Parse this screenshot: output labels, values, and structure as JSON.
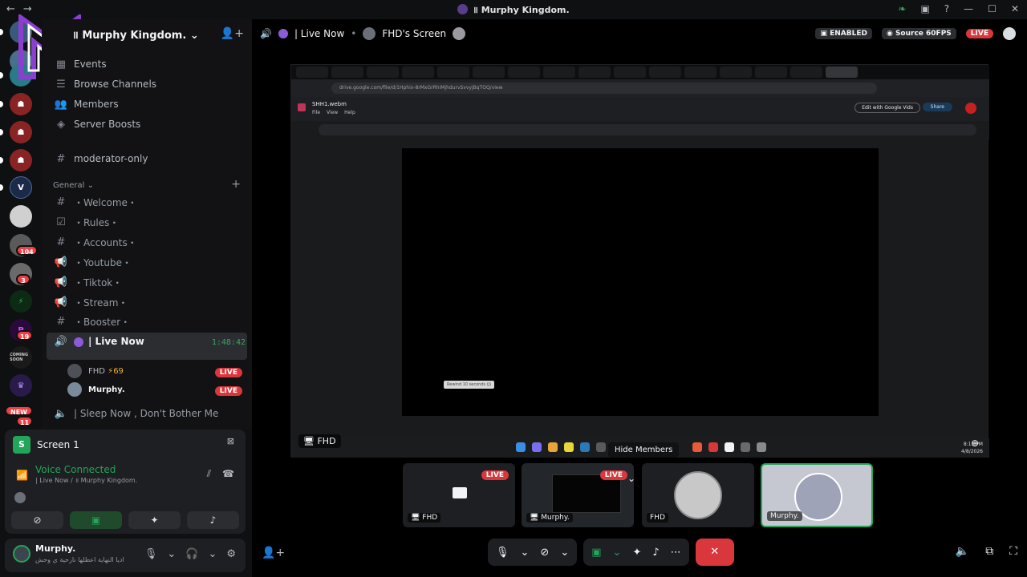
{
  "window": {
    "title": "॥ Murphy Kingdom.",
    "nav_back": "←",
    "nav_fwd": "→",
    "minimize": "—",
    "maximize": "☐",
    "close": "✕",
    "help": "?"
  },
  "server": {
    "name": "॥ Murphy Kingdom."
  },
  "server_badges": {
    "b1": "104",
    "b2": "3",
    "b3": "19",
    "b4": "11",
    "new": "NEW"
  },
  "coming_soon": "COMING SOON",
  "nav": {
    "events": "Events",
    "browse": "Browse Channels",
    "members": "Members",
    "boosts": "Server Boosts"
  },
  "channels": {
    "moderator": "moderator-only",
    "category": "General",
    "welcome": "・Welcome・",
    "rules": "・Rules・",
    "accounts": "・Accounts・",
    "youtube": "・Youtube・",
    "tiktok": "・Tiktok・",
    "stream": "・Stream・",
    "booster": "・Booster・",
    "live_now": "| Live Now",
    "live_timer": "1:48:42",
    "sleep": "| Sleep Now , Don't Bother Me"
  },
  "voice_users": [
    {
      "name": "FHD",
      "extra": "⚡69",
      "badge": "LIVE"
    },
    {
      "name": "Murphy.",
      "extra": "",
      "badge": "LIVE"
    }
  ],
  "panel": {
    "screen_title": "Screen 1",
    "voice_status": "Voice Connected",
    "voice_sub": "| Live Now / ॥ Murphy Kingdom."
  },
  "user": {
    "name": "Murphy.",
    "status": "اديا النهاية اعطلها نازحية ي وحش"
  },
  "stage": {
    "channel": "| Live Now",
    "streamer": "FHD's Screen",
    "enabled": "ENABLED",
    "source": "Source 60FPS",
    "live": "LIVE",
    "stream_label": "FHD",
    "hide_members": "Hide Members"
  },
  "browser": {
    "url": "drive.google.com/file/d/1Hphix-8rMxGrRhiMjhdurvSvvyjBqTOQ/view",
    "doc_title": "SHH1.webm",
    "doc_menu": "File View Help",
    "open_btn": "Edit with Google Vids",
    "share_btn": "Share",
    "rewind": "Rewind 10 seconds (J)",
    "clock_time": "8:13 PM",
    "clock_date": "4/8/2026"
  },
  "tiles": [
    {
      "label": "FHD",
      "live": "LIVE"
    },
    {
      "label": "Murphy.",
      "live": "LIVE"
    },
    {
      "label": "FHD"
    },
    {
      "label": "Murphy."
    }
  ],
  "colors": {
    "accent_green": "#23a559",
    "live_red": "#da373c",
    "purple": "#8c5cd8"
  }
}
